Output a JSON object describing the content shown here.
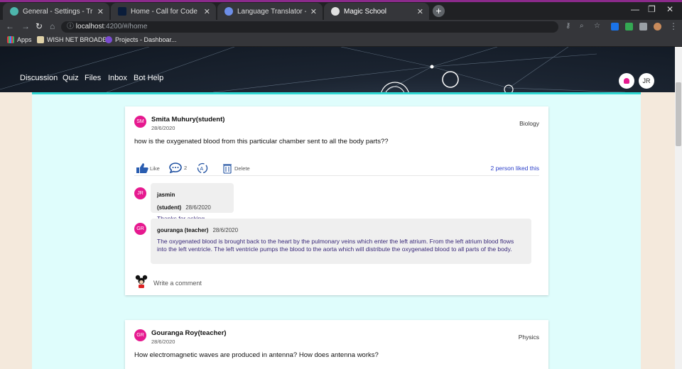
{
  "browser": {
    "tabs": [
      {
        "title": "General - Settings - Trisita Roy / M"
      },
      {
        "title": "Home - Call for Code"
      },
      {
        "title": "Language Translator - IBM Cloud"
      },
      {
        "title": "Magic School"
      }
    ],
    "new_tab": "+",
    "url_host": "localhost",
    "url_path": ":4200/#/home",
    "bookmarks": [
      {
        "label": "Apps"
      },
      {
        "label": "WISH NET BROADB..."
      },
      {
        "label": "Projects - Dashboar..."
      }
    ]
  },
  "nav": {
    "items": [
      "Discussion",
      "Quiz",
      "Files",
      "Inbox",
      "Bot Help"
    ],
    "user_initials": "JR"
  },
  "posts": [
    {
      "initials": "SM",
      "author": "Smita Muhury(student)",
      "date": "28/6/2020",
      "subject": "Biology",
      "question": "how is the oxygenated blood from this particular chamber sent to all the body parts??",
      "like_label": "Like",
      "comment_count": "2",
      "delete_label": "Delete",
      "liked_text": "2 person liked this",
      "comments": [
        {
          "initials": "JR",
          "author": "jasmin (student)",
          "date": "28/6/2020",
          "text": "Thanks for asking"
        },
        {
          "initials": "GR",
          "author": "gouranga (teacher)",
          "date": "28/6/2020",
          "text": "The oxygenated blood is brought back to the heart by the pulmonary veins which enter the left atrium. From the left atrium blood flows into the left ventricle. The left ventricle pumps the blood to the aorta which will distribute the oxygenated blood to all parts of the body."
        }
      ],
      "write_placeholder": "Write a comment"
    },
    {
      "initials": "GR",
      "author": "Gouranga Roy(teacher)",
      "date": "28/6/2020",
      "subject": "Physics",
      "question": "How electromagnetic waves are produced in antenna? How does antenna works?"
    }
  ],
  "colors": {
    "avatar": "#e6198f",
    "panel": "#dffdfc",
    "accent_border": "#2fd7d2",
    "liked_link": "#2b3fc9"
  }
}
